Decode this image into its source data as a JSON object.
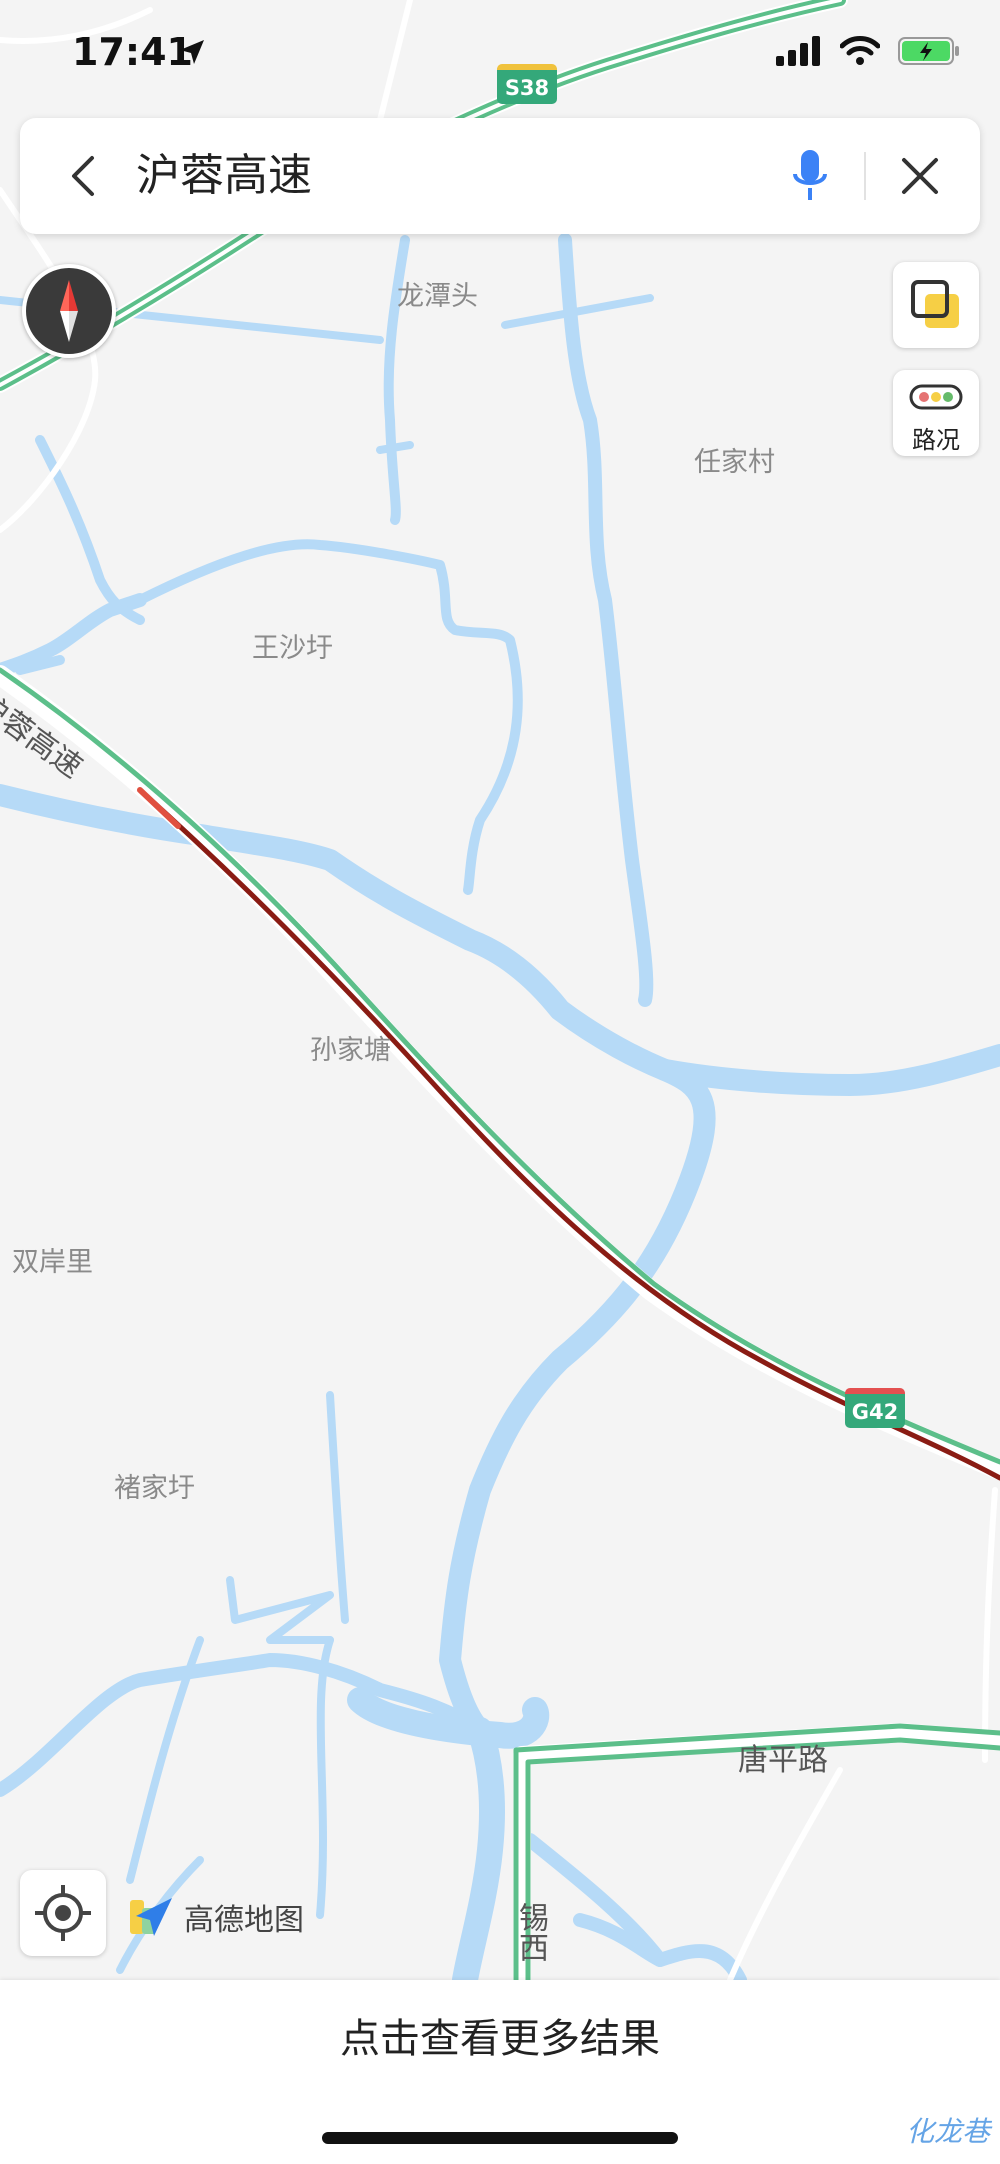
{
  "status_bar": {
    "time": "17:41"
  },
  "search": {
    "query": "沪蓉高速"
  },
  "traffic_button": {
    "label": "路况"
  },
  "map": {
    "places": [
      "龙潭头",
      "任家村",
      "王沙圩",
      "孙家塘",
      "双岸里",
      "褚家圩"
    ],
    "roads": {
      "highway_name": "沪蓉高速",
      "tangping": "唐平路",
      "xixi": "锡西"
    },
    "shields": {
      "s38": "S38",
      "g42": "G42"
    }
  },
  "logo": {
    "text": "高德地图"
  },
  "bottom": {
    "more_results": "点击查看更多结果",
    "watermark": "化龙巷"
  },
  "colors": {
    "route_green": "#5cbf8a",
    "route_red": "#8a1c14",
    "water": "#b6daf7"
  }
}
